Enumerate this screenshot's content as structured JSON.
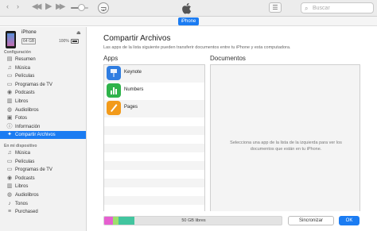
{
  "toolbar": {
    "back_glyph": "‹",
    "forward_glyph": "›",
    "prev_glyph": "◀◀",
    "play_glyph": "▶",
    "next_glyph": "▶▶",
    "volume_level": 0.55,
    "list_glyph": "☰",
    "search_icon": "⌕",
    "search_placeholder": "Buscar",
    "icons": [
      "back-arrow-icon",
      "forward-arrow-icon",
      "previous-track-icon",
      "play-icon",
      "next-track-icon",
      "airplay-icon",
      "apple-logo-icon",
      "list-view-icon",
      "search-icon"
    ]
  },
  "device_tab": {
    "label": "iPhone"
  },
  "device": {
    "name": "iPhone",
    "capacity": "64 GB",
    "battery": "100%",
    "battery_level": 1.0,
    "eject_glyph": "⏏"
  },
  "sidebar": {
    "settings_header": "Configuración",
    "settings_items": [
      {
        "label": "Resumen",
        "glyph": "▤",
        "icon": "summary-icon"
      },
      {
        "label": "Música",
        "glyph": "♫",
        "icon": "music-icon"
      },
      {
        "label": "Películas",
        "glyph": "▭",
        "icon": "movies-icon"
      },
      {
        "label": "Programas de TV",
        "glyph": "▭",
        "icon": "tv-icon"
      },
      {
        "label": "Podcasts",
        "glyph": "◉",
        "icon": "podcast-icon"
      },
      {
        "label": "Libros",
        "glyph": "▥",
        "icon": "books-icon"
      },
      {
        "label": "Audiolibros",
        "glyph": "◍",
        "icon": "audiobooks-icon"
      },
      {
        "label": "Fotos",
        "glyph": "▣",
        "icon": "photos-icon"
      },
      {
        "label": "Información",
        "glyph": "ⓘ",
        "icon": "info-icon"
      },
      {
        "label": "Compartir Archivos",
        "glyph": "✦",
        "icon": "file-sharing-icon",
        "selected": true
      }
    ],
    "on_device_header": "En mi dispositivo",
    "device_items": [
      {
        "label": "Música",
        "glyph": "♫",
        "icon": "music-icon"
      },
      {
        "label": "Películas",
        "glyph": "▭",
        "icon": "movies-icon"
      },
      {
        "label": "Programas de TV",
        "glyph": "▭",
        "icon": "tv-icon"
      },
      {
        "label": "Podcasts",
        "glyph": "◉",
        "icon": "podcast-icon"
      },
      {
        "label": "Libros",
        "glyph": "▥",
        "icon": "books-icon"
      },
      {
        "label": "Audiolibros",
        "glyph": "◍",
        "icon": "audiobooks-icon"
      },
      {
        "label": "Tonos",
        "glyph": "♪",
        "icon": "tones-icon"
      },
      {
        "label": "Purchased",
        "glyph": "≡",
        "icon": "purchased-icon"
      }
    ]
  },
  "main": {
    "title": "Compartir Archivos",
    "description": "Las apps de la lista siguiente pueden transferir documentos entre tu iPhone y esta computadora.",
    "apps_header": "Apps",
    "documents_header": "Documentos",
    "apps": [
      {
        "name": "Keynote",
        "color": "#2f7de1",
        "icon": "keynote-icon"
      },
      {
        "name": "Numbers",
        "color": "#2eb34a",
        "icon": "numbers-icon"
      },
      {
        "name": "Pages",
        "color": "#f29a1a",
        "icon": "pages-icon"
      }
    ],
    "documents_empty": "Selecciona una app de la lista de la izquierda para ver los documentos que están en tu iPhone."
  },
  "footer": {
    "storage_label": "50 GB libres",
    "storage_segments": [
      {
        "category": "apps",
        "fraction": 0.05,
        "color": "#e65fd0"
      },
      {
        "category": "media",
        "fraction": 0.03,
        "color": "#9ee06c"
      },
      {
        "category": "other",
        "fraction": 0.09,
        "color": "#42c59f"
      }
    ],
    "sync_label": "Sincronizar",
    "ok_label": "OK"
  },
  "colors": {
    "accent": "#1b7cf2",
    "sidebar_bg": "#f2f2f2",
    "toolbar_bg": "#ececec"
  }
}
